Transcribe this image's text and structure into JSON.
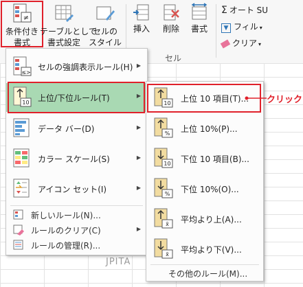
{
  "ribbon": {
    "conditional_formatting": "条件付き\n書式",
    "format_as_table": "テーブルとして\n書式設定",
    "cell_styles": "セルの\nスタイル",
    "insert": "挿入",
    "delete": "削除",
    "format": "書式",
    "autosum": "オート SU",
    "fill": "フィル",
    "clear": "クリア",
    "cells_group_label": "セル"
  },
  "menu": {
    "items": [
      {
        "label": "セルの強調表示ルール(H)",
        "icon": "highlight-cells-rules-icon"
      },
      {
        "label": "上位/下位ルール(T)",
        "icon": "top-bottom-rules-icon"
      },
      {
        "label": "データ バー(D)",
        "icon": "data-bars-icon"
      },
      {
        "label": "カラー スケール(S)",
        "icon": "color-scales-icon"
      },
      {
        "label": "アイコン セット(I)",
        "icon": "icon-sets-icon"
      }
    ],
    "small_items": [
      {
        "label": "新しいルール(N)...",
        "icon": "new-rule-icon"
      },
      {
        "label": "ルールのクリア(C)",
        "icon": "clear-rules-icon"
      },
      {
        "label": "ルールの管理(R)...",
        "icon": "manage-rules-icon"
      }
    ]
  },
  "submenu": {
    "items": [
      {
        "label": "上位 10 項目(T)...",
        "badge": "10"
      },
      {
        "label": "上位 10%(P)...",
        "badge": "%"
      },
      {
        "label": "下位 10 項目(B)...",
        "badge": "10"
      },
      {
        "label": "下位 10%(O)...",
        "badge": "%"
      },
      {
        "label": "平均より上(A)...",
        "badge": "x̄"
      },
      {
        "label": "平均より下(V)...",
        "badge": "x̄"
      }
    ],
    "more": "その他のルール(M)..."
  },
  "annotation": {
    "click_label": "クリック"
  },
  "watermark": "JPITA",
  "colors": {
    "highlight": "#a9d9b3",
    "callout": "#e0202a"
  }
}
